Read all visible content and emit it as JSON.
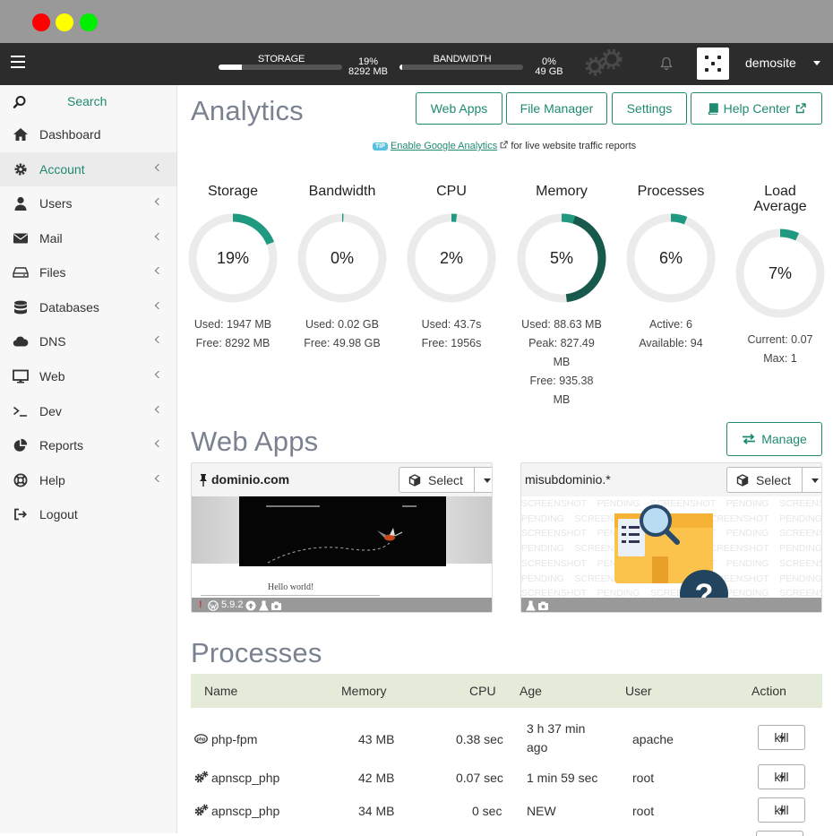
{
  "topbar": {
    "storage": {
      "label": "STORAGE",
      "percent_text": "19%",
      "amount": "8292 MB",
      "fill_percent": 19
    },
    "bandwidth": {
      "label": "BANDWIDTH",
      "percent_text": "0%",
      "amount": "49 GB",
      "fill_percent": 2
    },
    "username": "demosite"
  },
  "sidebar": {
    "search": "Search",
    "items": [
      {
        "label": "Dashboard",
        "icon": "home-icon"
      },
      {
        "label": "Account",
        "icon": "gear-icon",
        "active": true
      },
      {
        "label": "Users",
        "icon": "user-icon"
      },
      {
        "label": "Mail",
        "icon": "envelope-icon"
      },
      {
        "label": "Files",
        "icon": "hdd-icon"
      },
      {
        "label": "Databases",
        "icon": "database-icon"
      },
      {
        "label": "DNS",
        "icon": "cloud-icon"
      },
      {
        "label": "Web",
        "icon": "monitor-icon"
      },
      {
        "label": "Dev",
        "icon": "terminal-icon"
      },
      {
        "label": "Reports",
        "icon": "pie-chart-icon"
      },
      {
        "label": "Help",
        "icon": "life-ring-icon"
      },
      {
        "label": "Logout",
        "icon": "sign-out-icon"
      }
    ]
  },
  "analytics": {
    "title": "Analytics",
    "buttons": {
      "web_apps": "Web Apps",
      "file_manager": "File Manager",
      "settings": "Settings",
      "help_center": "Help Center"
    },
    "tip": {
      "badge": "TIP",
      "link": "Enable Google Analytics",
      "rest": "for live website traffic reports"
    }
  },
  "gauges": [
    {
      "title": "Storage",
      "value": "19%",
      "percent": 19,
      "color": "#1f9a80",
      "stats": [
        "Used: 1947 MB",
        "Free: 8292 MB"
      ]
    },
    {
      "title": "Bandwidth",
      "value": "0%",
      "percent": 0,
      "color": "#1f9a80",
      "stats": [
        "Used: 0.02 GB",
        "Free: 49.98 GB"
      ]
    },
    {
      "title": "CPU",
      "value": "2%",
      "percent": 2,
      "color": "#1f9a80",
      "stats": [
        "Used: 43.7s",
        "Free: 1956s"
      ]
    },
    {
      "title": "Memory",
      "value": "5%",
      "percent": 5,
      "secondary_percent": 48,
      "color": "#1f9a80",
      "secondary_color": "#17594a",
      "stats": [
        "Used: 88.63 MB",
        "Peak: 827.49",
        "MB",
        "Free: 935.38",
        "MB"
      ]
    },
    {
      "title": "Processes",
      "value": "6%",
      "percent": 6,
      "color": "#1f9a80",
      "stats": [
        "Active: 6",
        "Available: 94"
      ]
    },
    {
      "title_lines": [
        "Load",
        "Average"
      ],
      "value": "7%",
      "percent": 7,
      "color": "#1f9a80",
      "stats": [
        "Current: 0.07",
        "Max: 1"
      ]
    }
  ],
  "webapps": {
    "title": "Web Apps",
    "manage": "Manage",
    "cards": [
      {
        "name": "dominio.com",
        "select": "Select",
        "version": "5.9.2",
        "preview_text": "Hello world!"
      },
      {
        "name": "misubdominio.*",
        "select": "Select",
        "pending_word_1": "SCREENSHOT",
        "pending_word_2": "PENDING"
      }
    ]
  },
  "processes": {
    "title": "Processes",
    "headers": {
      "name": "Name",
      "memory": "Memory",
      "cpu": "CPU",
      "age": "Age",
      "user": "User",
      "action": "Action"
    },
    "rows": [
      {
        "name": "php-fpm",
        "memory": "43 MB",
        "cpu": "0.38 sec",
        "age_1": "3 h 37 min",
        "age_2": "ago",
        "user": "apache",
        "action": "kill"
      },
      {
        "name": "apnscp_php",
        "memory": "42 MB",
        "cpu": "0.07 sec",
        "age_1": "1 min 59 sec",
        "age_2": "",
        "user": "root",
        "action": "kill"
      },
      {
        "name": "apnscp_php",
        "memory": "34 MB",
        "cpu": "0 sec",
        "age_1": "NEW",
        "age_2": "",
        "user": "root",
        "action": "kill"
      }
    ]
  }
}
